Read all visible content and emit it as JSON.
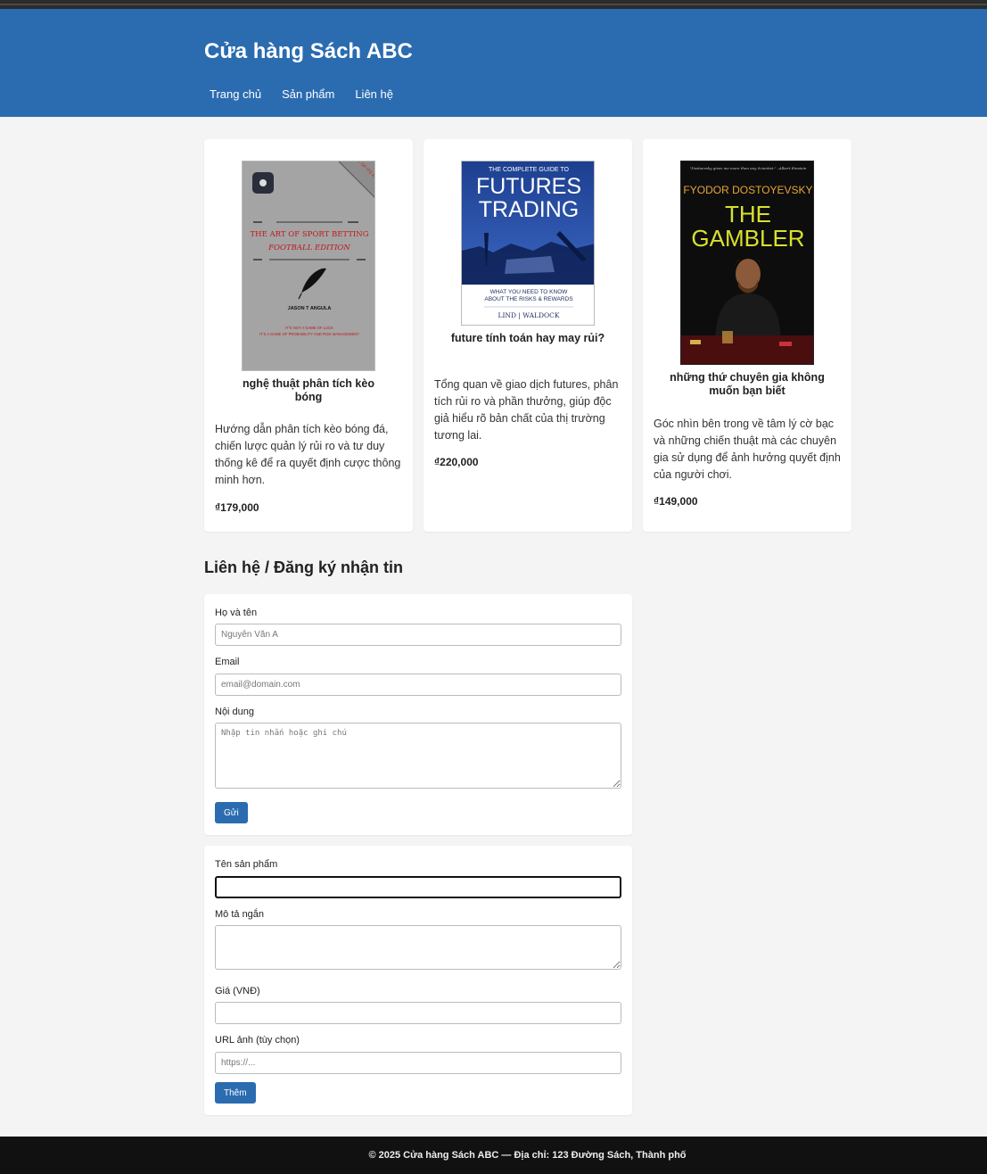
{
  "site": {
    "title": "Cửa hàng Sách ABC"
  },
  "nav": {
    "items": [
      "Trang chủ",
      "Sản phẩm",
      "Liên hệ"
    ]
  },
  "products": [
    {
      "title": "nghệ thuật phân tích kèo bóng",
      "description": "Hướng dẫn phân tích kèo bóng đá, chiến lược quản lý rủi ro và tư duy thống kê để ra quyết định cược thông minh hơn.",
      "price": "₫179,000",
      "cover": {
        "title_line1": "THE ART OF SPORT BETTING",
        "title_line2": "FOOTBALL EDITION",
        "author": "JASON T ANGULA",
        "tag1": "IT'S NOT A GAME OF LUCK",
        "tag2": "IT'S A GAME OF PROBABILITY AND RISK MANAGEMENT",
        "corner": "FIRST OF ITS KIND"
      }
    },
    {
      "title": "future tính toán hay may rủi?",
      "description": "Tổng quan về giao dịch futures, phân tích rủi ro và phần thưởng, giúp độc giả hiểu rõ bản chất của thị trường tương lai.",
      "price": "₫220,000",
      "cover": {
        "top": "THE COMPLETE GUIDE TO",
        "title_line1": "FUTURES",
        "title_line2": "TRADING",
        "sub1": "WHAT YOU NEED TO KNOW",
        "sub2": "ABOUT THE RISKS & REWARDS",
        "authors": "LIND | WALDOCK"
      }
    },
    {
      "title": "những thứ chuyên gia không muốn bạn biết",
      "description": "Góc nhìn bên trong về tâm lý cờ bạc và những chiến thuật mà các chuyên gia sử dụng để ảnh hưởng quyết định của người chơi.",
      "price": "₫149,000",
      "cover": {
        "quote": "\"Dostoevsky gives me more than any Scientist.\" –Albert Einstein",
        "author": "FYODOR DOSTOYEVSKY",
        "title_line1": "THE",
        "title_line2": "GAMBLER"
      }
    }
  ],
  "contact": {
    "heading": "Liên hệ / Đăng ký nhận tin",
    "name_label": "Họ và tên",
    "name_placeholder": "Nguyễn Văn A",
    "email_label": "Email",
    "email_placeholder": "email@domain.com",
    "message_label": "Nội dung",
    "message_placeholder": "Nhập tin nhắn hoặc ghi chú",
    "submit_label": "Gửi"
  },
  "add_product": {
    "name_label": "Tên sản phẩm",
    "desc_label": "Mô tả ngắn",
    "price_label": "Giá (VNĐ)",
    "image_label": "URL ảnh (tùy chọn)",
    "image_placeholder": "https://...",
    "submit_label": "Thêm"
  },
  "footer": {
    "text": "© 2025 Cửa hàng Sách ABC — Địa chỉ: 123 Đường Sách, Thành phố"
  },
  "colors": {
    "header": "#2b6cb0",
    "button": "#2b6cb0",
    "footer": "#111111",
    "background": "#f4f4f4"
  }
}
